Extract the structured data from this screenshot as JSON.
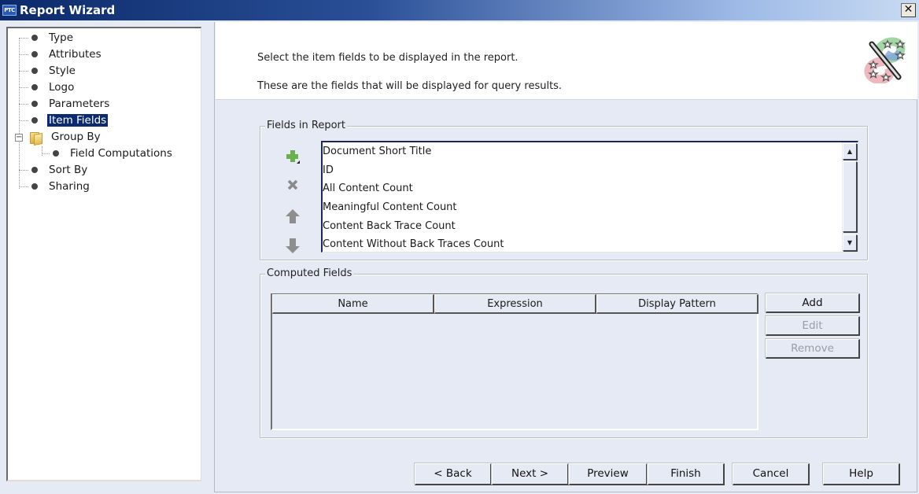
{
  "window": {
    "app_icon_label": "PTC",
    "title": "Report Wizard",
    "close_label": "✕"
  },
  "tree": {
    "items": [
      {
        "label": "Type",
        "level": 0,
        "icon": "bullet-icon",
        "selected": false
      },
      {
        "label": "Attributes",
        "level": 0,
        "icon": "bullet-icon",
        "selected": false
      },
      {
        "label": "Style",
        "level": 0,
        "icon": "bullet-icon",
        "selected": false
      },
      {
        "label": "Logo",
        "level": 0,
        "icon": "bullet-icon",
        "selected": false
      },
      {
        "label": "Parameters",
        "level": 0,
        "icon": "bullet-icon",
        "selected": false
      },
      {
        "label": "Item Fields",
        "level": 0,
        "icon": "bullet-icon",
        "selected": true
      },
      {
        "label": "Group By",
        "level": 0,
        "icon": "folder-icon",
        "expanded": true,
        "selected": false
      },
      {
        "label": "Field Computations",
        "level": 1,
        "icon": "bullet-icon",
        "selected": false
      },
      {
        "label": "Sort By",
        "level": 0,
        "icon": "bullet-icon",
        "selected": false
      },
      {
        "label": "Sharing",
        "level": 0,
        "icon": "bullet-icon",
        "selected": false
      }
    ],
    "expander_symbol": "−"
  },
  "header": {
    "line1": "Select the item fields to be displayed in the report.",
    "line2": "These are the fields that will be displayed for query results.",
    "icon": "magic-wand-icon"
  },
  "fields_in_report": {
    "title": "Fields in Report",
    "items": [
      "Document Short Title",
      "ID",
      "All Content Count",
      "Meaningful Content Count",
      "Content Back Trace Count",
      "Content Without Back Traces Count"
    ],
    "actions": [
      {
        "name": "add-field",
        "icon": "plus-icon",
        "enabled": true
      },
      {
        "name": "remove-field",
        "icon": "delete-icon",
        "enabled": false
      },
      {
        "name": "move-up",
        "icon": "arrow-up-icon",
        "enabled": false
      },
      {
        "name": "move-down",
        "icon": "arrow-down-icon",
        "enabled": false
      }
    ],
    "scroll_up": "▲",
    "scroll_down": "▼"
  },
  "computed_fields": {
    "title": "Computed Fields",
    "columns": [
      "Name",
      "Expression",
      "Display Pattern"
    ],
    "rows": [],
    "buttons": {
      "add": "Add",
      "edit": "Edit",
      "remove": "Remove"
    }
  },
  "footer": {
    "back": "< Back",
    "next": "Next >",
    "preview": "Preview",
    "finish": "Finish",
    "cancel": "Cancel",
    "help": "Help"
  },
  "colors": {
    "title_bar_start": "#0c2a6a",
    "selection": "#0b2a6f",
    "panel_bg": "#e6eaf5",
    "add_icon_green": "#6ab04c"
  }
}
